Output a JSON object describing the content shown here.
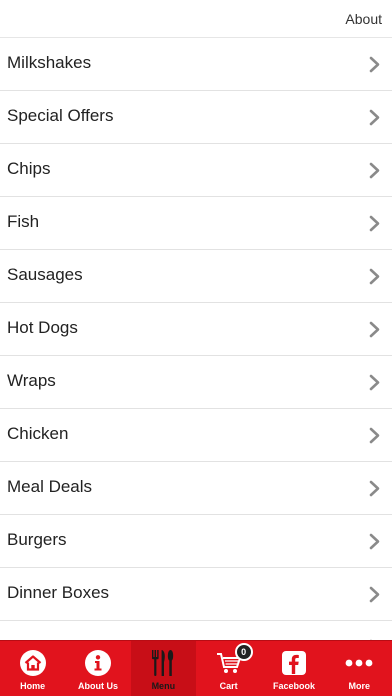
{
  "header": {
    "about_label": "About"
  },
  "menu": {
    "items": [
      {
        "label": "Milkshakes"
      },
      {
        "label": "Special Offers"
      },
      {
        "label": "Chips"
      },
      {
        "label": "Fish"
      },
      {
        "label": "Sausages"
      },
      {
        "label": "Hot Dogs"
      },
      {
        "label": "Wraps"
      },
      {
        "label": "Chicken"
      },
      {
        "label": "Meal Deals"
      },
      {
        "label": "Burgers"
      },
      {
        "label": "Dinner Boxes"
      },
      {
        "label": ""
      }
    ],
    "chevron_icon": "chevron-right-icon"
  },
  "tabbar": {
    "accent_color": "#e1131d",
    "tabs": [
      {
        "label": "Home",
        "icon": "home-icon"
      },
      {
        "label": "About Us",
        "icon": "info-icon"
      },
      {
        "label": "Menu",
        "icon": "cutlery-icon",
        "active": true
      },
      {
        "label": "Cart",
        "icon": "cart-icon",
        "badge": "0"
      },
      {
        "label": "Facebook",
        "icon": "facebook-icon"
      },
      {
        "label": "More",
        "icon": "more-icon"
      }
    ]
  }
}
